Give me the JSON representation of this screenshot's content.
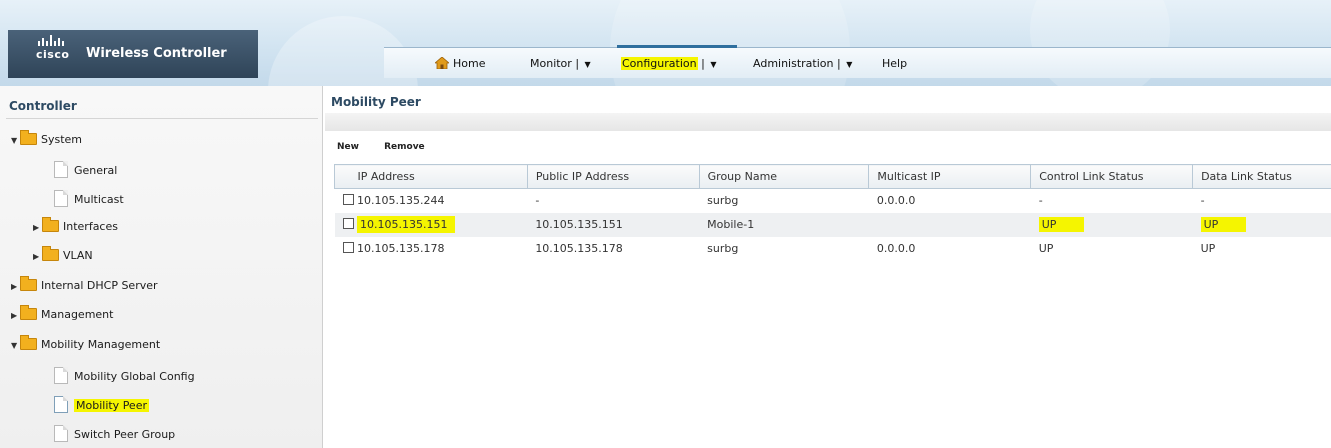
{
  "header": {
    "brand_word": "cisco",
    "product_title": "Wireless Controller"
  },
  "nav": {
    "home": "Home",
    "monitor": "Monitor",
    "configuration": "Configuration",
    "administration": "Administration",
    "help": "Help",
    "separator": "|",
    "caret": "▼",
    "active": "configuration"
  },
  "sidebar": {
    "title": "Controller",
    "items": {
      "system": "System",
      "general": "General",
      "multicast": "Multicast",
      "interfaces": "Interfaces",
      "vlan": "VLAN",
      "internal_dhcp": "Internal DHCP Server",
      "management": "Management",
      "mobility_management": "Mobility Management",
      "mobility_global_config": "Mobility Global Config",
      "mobility_peer": "Mobility Peer",
      "switch_peer_group": "Switch Peer Group"
    }
  },
  "main": {
    "title": "Mobility Peer",
    "toolbar": {
      "new": "New",
      "remove": "Remove"
    },
    "table": {
      "headers": {
        "ip": "IP Address",
        "public_ip": "Public IP Address",
        "group": "Group Name",
        "multicast": "Multicast IP",
        "control": "Control Link Status",
        "data": "Data Link Status"
      },
      "rows": [
        {
          "ip": "10.105.135.244",
          "public_ip": "-",
          "group": "surbg",
          "multicast": "0.0.0.0",
          "control": "-",
          "data": "-"
        },
        {
          "ip": "10.105.135.151",
          "public_ip": "10.105.135.151",
          "group": "Mobile-1",
          "multicast": "",
          "control": "UP",
          "data": "UP"
        },
        {
          "ip": "10.105.135.178",
          "public_ip": "10.105.135.178",
          "group": "surbg",
          "multicast": "0.0.0.0",
          "control": "UP",
          "data": "UP"
        }
      ]
    }
  },
  "colors": {
    "highlight": "#f5f500",
    "brand_bg": "#3c5369",
    "title_text": "#2d4a63",
    "folder": "#f2b01e"
  }
}
